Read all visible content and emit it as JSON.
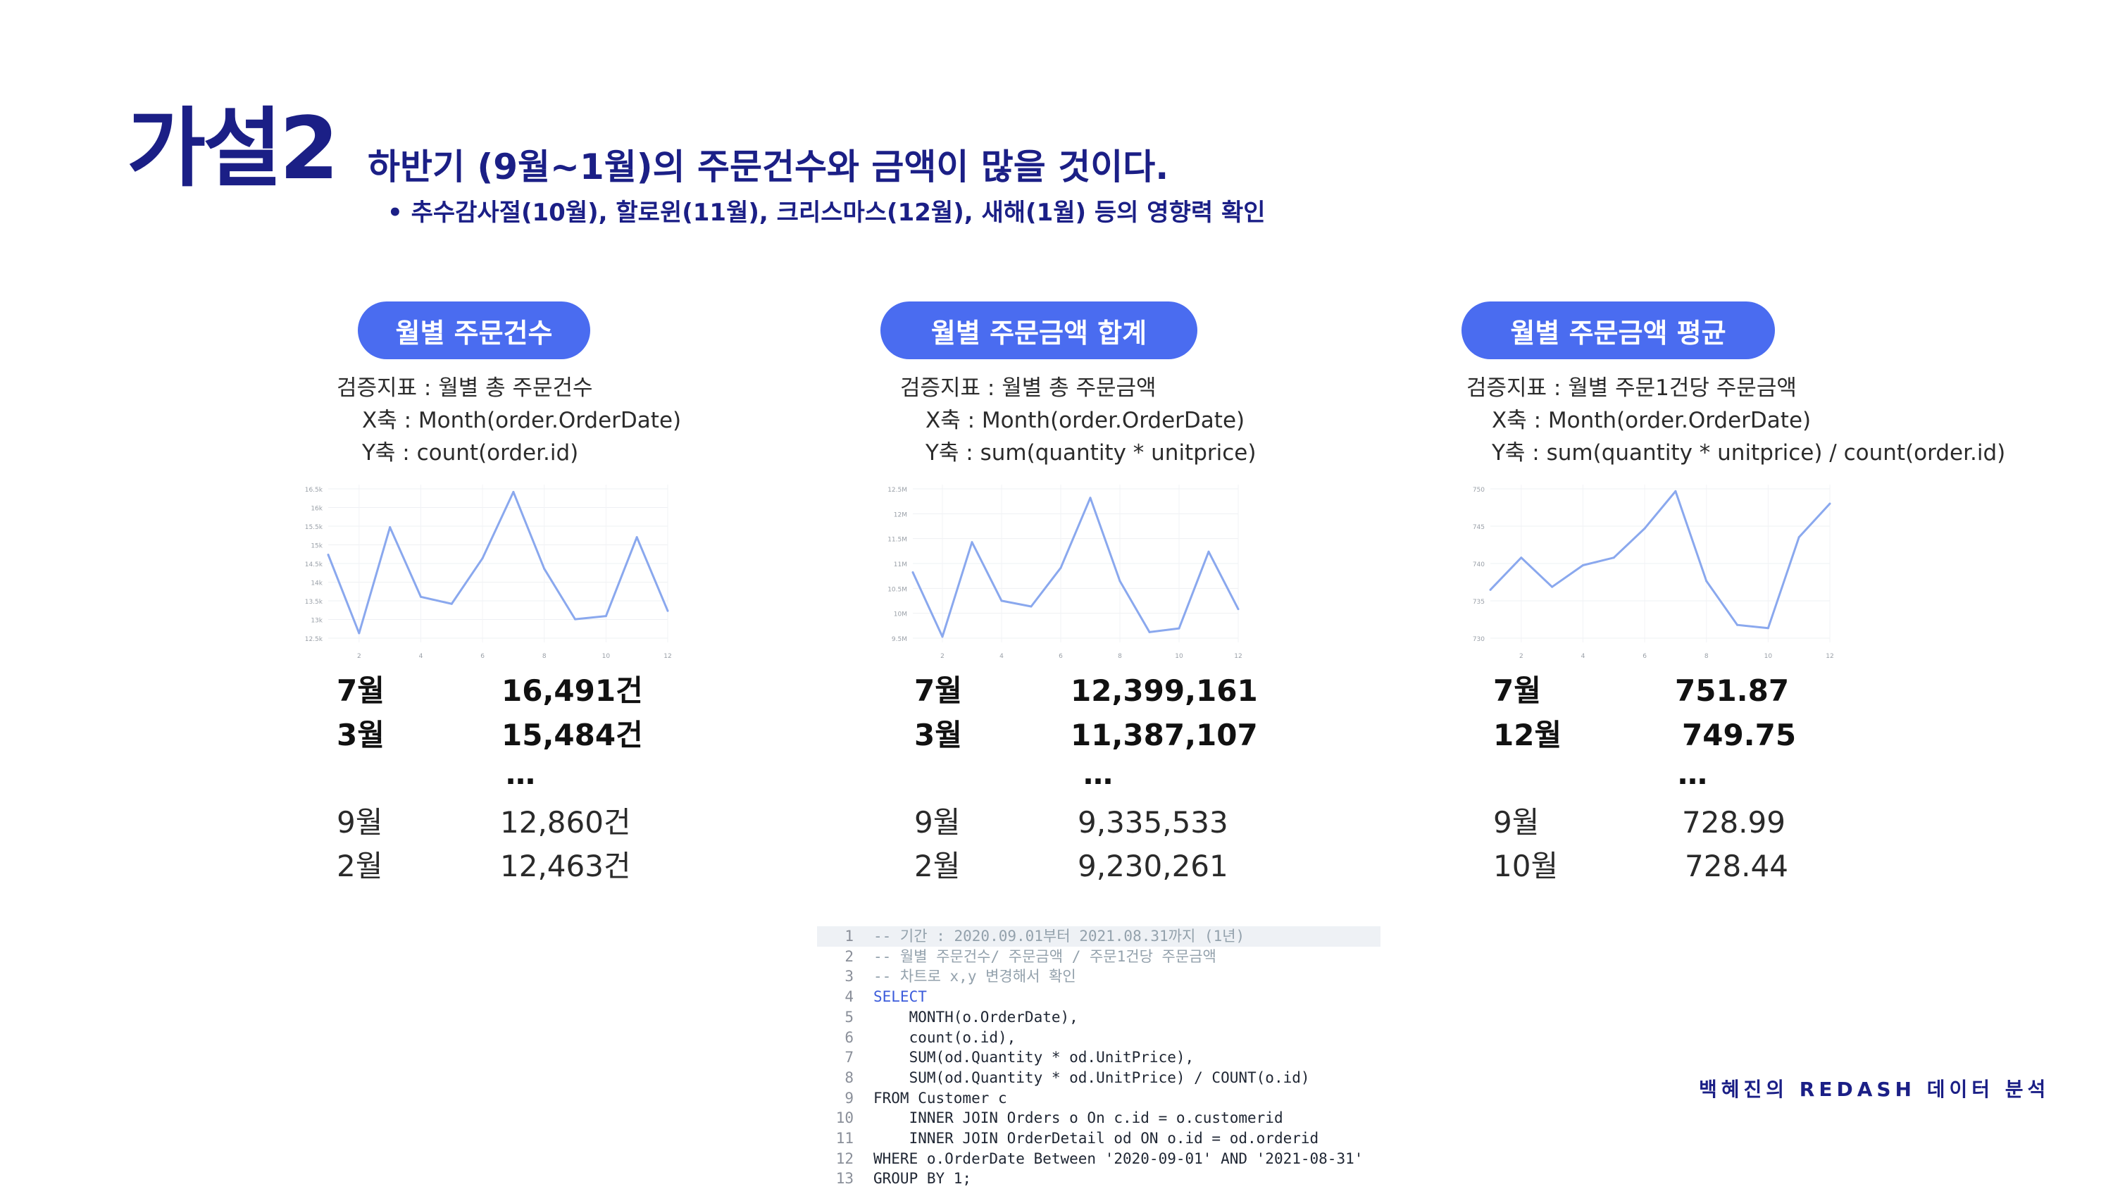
{
  "header": {
    "title": "가설2",
    "headline": "하반기 (9월~1월)의 주문건수와 금액이 많을 것이다.",
    "bullet": "• 추수감사절(10월), 할로윈(11월), 크리스마스(12월), 새해(1월) 등의 영향력 확인"
  },
  "panels": [
    {
      "pill": "월별 주문건수",
      "metric": "검증지표 : 월별 총 주문건수",
      "x_axis": "X축 : Month(order.OrderDate)",
      "y_axis": "Y축 : count(order.id)",
      "stats": [
        {
          "month": "7월",
          "value": "16,491건"
        },
        {
          "month": "3월",
          "value": "15,484건"
        },
        {
          "ellipsis": "…"
        },
        {
          "month": "9월",
          "value": "12,860건"
        },
        {
          "month": "2월",
          "value": "12,463건"
        }
      ]
    },
    {
      "pill": "월별 주문금액 합계",
      "metric": "검증지표 : 월별 총 주문금액",
      "x_axis": "X축 : Month(order.OrderDate)",
      "y_axis": "Y축 : sum(quantity * unitprice)",
      "stats": [
        {
          "month": "7월",
          "value": "12,399,161"
        },
        {
          "month": "3월",
          "value": "11,387,107"
        },
        {
          "ellipsis": "…"
        },
        {
          "month": "9월",
          "value": "9,335,533"
        },
        {
          "month": "2월",
          "value": "9,230,261"
        }
      ]
    },
    {
      "pill": "월별 주문금액 평균",
      "metric": "검증지표 : 월별 주문1건당 주문금액",
      "x_axis": "X축 : Month(order.OrderDate)",
      "y_axis": "Y축 : sum(quantity * unitprice) / count(order.id)",
      "stats": [
        {
          "month": "7월",
          "value": "751.87"
        },
        {
          "month": "12월",
          "value": "749.75"
        },
        {
          "ellipsis": "…"
        },
        {
          "month": "9월",
          "value": "728.99"
        },
        {
          "month": "10월",
          "value": "728.44"
        }
      ]
    }
  ],
  "chart_data": [
    {
      "type": "line",
      "x": [
        1,
        2,
        3,
        4,
        5,
        6,
        7,
        8,
        9,
        10,
        11,
        12
      ],
      "series": [
        {
          "values": [
            14700,
            12463,
            15484,
            13500,
            13300,
            14600,
            16491,
            14300,
            12860,
            12950,
            15200,
            13100
          ]
        }
      ],
      "yticks": [
        "16.5k",
        "16k",
        "15.5k",
        "15k",
        "14.5k",
        "14k",
        "13.5k",
        "13k",
        "12.5k"
      ],
      "xticks": [
        "2",
        "4",
        "6",
        "8",
        "10",
        "12"
      ],
      "ylim": [
        12200,
        16700
      ],
      "color": "#8aa8ee"
    },
    {
      "type": "line",
      "x": [
        1,
        2,
        3,
        4,
        5,
        6,
        7,
        8,
        9,
        10,
        11,
        12
      ],
      "series": [
        {
          "values": [
            10700000,
            9230261,
            11387107,
            10050000,
            9920000,
            10800000,
            12399161,
            10500000,
            9335533,
            9420000,
            11170000,
            9860000
          ]
        }
      ],
      "yticks": [
        "12.5M",
        "12M",
        "11.5M",
        "11M",
        "10.5M",
        "10M",
        "9.5M"
      ],
      "xticks": [
        "2",
        "4",
        "6",
        "8",
        "10",
        "12"
      ],
      "ylim": [
        9100000,
        12700000
      ],
      "color": "#8aa8ee"
    },
    {
      "type": "line",
      "x": [
        1,
        2,
        3,
        4,
        5,
        6,
        7,
        8,
        9,
        10,
        11,
        12
      ],
      "series": [
        {
          "values": [
            735,
            740.5,
            735.5,
            739.2,
            740.5,
            745.5,
            751.87,
            736.5,
            728.99,
            728.44,
            744,
            749.75
          ]
        }
      ],
      "yticks": [
        "750",
        "745",
        "740",
        "735",
        "730"
      ],
      "xticks": [
        "2",
        "4",
        "6",
        "8",
        "10",
        "12"
      ],
      "ylim": [
        726,
        753
      ],
      "color": "#8aa8ee"
    }
  ],
  "code": {
    "lines": [
      {
        "n": "1",
        "t": "-- 기간 : 2020.09.01부터 2021.08.31까지 (1년)",
        "k": "comment"
      },
      {
        "n": "2",
        "t": "-- 월별 주문건수/ 주문금액 / 주문1건당 주문금액",
        "k": "comment"
      },
      {
        "n": "3",
        "t": "-- 차트로 x,y 변경해서 확인",
        "k": "comment"
      },
      {
        "n": "4",
        "t": "SELECT",
        "k": "kw"
      },
      {
        "n": "5",
        "t": "    MONTH(o.OrderDate),",
        "k": ""
      },
      {
        "n": "6",
        "t": "    count(o.id),",
        "k": ""
      },
      {
        "n": "7",
        "t": "    SUM(od.Quantity * od.UnitPrice),",
        "k": ""
      },
      {
        "n": "8",
        "t": "    SUM(od.Quantity * od.UnitPrice) / COUNT(o.id)",
        "k": ""
      },
      {
        "n": "9",
        "t": "FROM Customer c",
        "k": ""
      },
      {
        "n": "10",
        "t": "    INNER JOIN Orders o On c.id = o.customerid",
        "k": ""
      },
      {
        "n": "11",
        "t": "    INNER JOIN OrderDetail od ON o.id = od.orderid",
        "k": ""
      },
      {
        "n": "12",
        "t": "WHERE o.OrderDate Between '2020-09-01' AND '2021-08-31'",
        "k": ""
      },
      {
        "n": "13",
        "t": "GROUP BY 1;",
        "k": ""
      }
    ]
  },
  "footer": {
    "text": "백혜진의 REDASH 데이터 분석"
  }
}
